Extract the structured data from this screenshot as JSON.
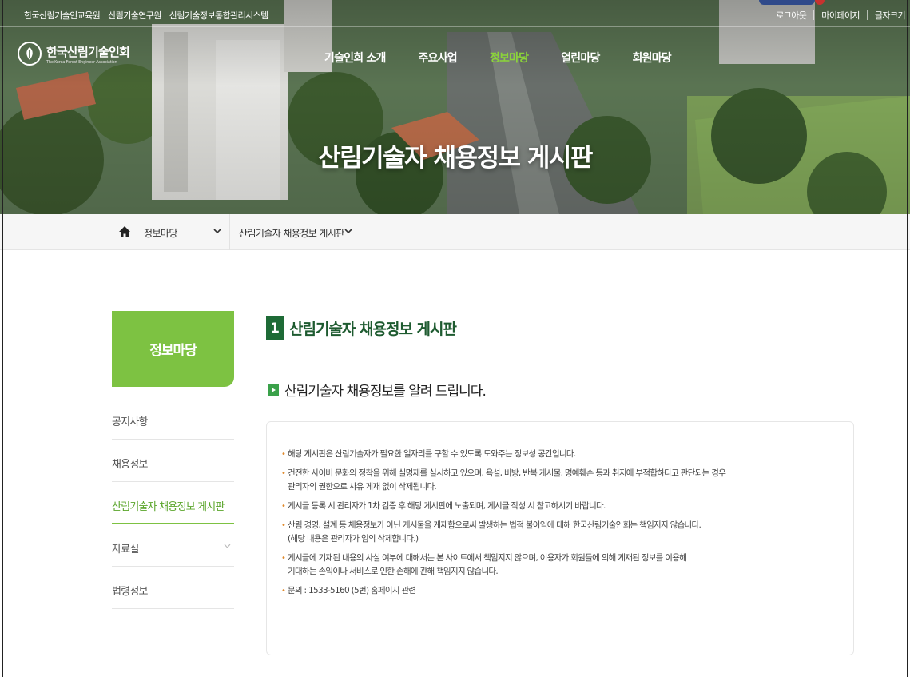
{
  "top_links_left": [
    "한국산림기술인교육원",
    "산림기술연구원",
    "산림기술정보통합관리시스템"
  ],
  "top_links_right": [
    "로그아웃",
    "마이페이지",
    "글자크기"
  ],
  "logo": {
    "title": "한국산림기술인회",
    "subtitle": "The Korea Forest Engineer Association"
  },
  "gnb": [
    "기술인회 소개",
    "주요사업",
    "정보마당",
    "열린마당",
    "회원마당"
  ],
  "gnb_active_index": 2,
  "hero_title": "산림기술자 채용정보 게시판",
  "breadcrumb": {
    "level1": "정보마당",
    "level2": "산림기술자 채용정보 게시판"
  },
  "lnb": {
    "title": "정보마당",
    "items": [
      {
        "label": "공지사항"
      },
      {
        "label": "채용정보"
      },
      {
        "label": "산림기술자 채용정보 게시판"
      },
      {
        "label": "자료실"
      },
      {
        "label": "법령정보"
      }
    ]
  },
  "section": {
    "number": "1",
    "title": "산림기술자 채용정보 게시판"
  },
  "subtitle": "산림기술자 채용정보를 알려 드립니다.",
  "notices": [
    [
      "해당 게시판은 산림기술자가 필요한 일자리를 구할 수 있도록 도와주는 정보성 공간입니다."
    ],
    [
      "건전한 사이버 문화의 정착을 위해 실명제를 실시하고 있으며, 욕설, 비방, 반복 게시물, 명예훼손 등과 취지에 부적합하다고 판단되는 경우",
      "관리자의 권한으로 사유 게재 없이 삭제됩니다."
    ],
    [
      "게시글 등록 시 관리자가 1차 검증 후 해당 게시판에 노출되며, 게시글 작성 시 참고하시기 바랍니다."
    ],
    [
      "산림 경영, 설계 등 채용정보가 아닌 게시물을 게재함으로써 발생하는 법적 불이익에 대해 한국산림기술인회는 책임지지 않습니다.",
      "(해당 내용은 관리자가 임의 삭제합니다.)"
    ],
    [
      "게시글에 기재된 내용의 사실 여부에 대해서는 본 사이트에서 책임지지 않으며, 이용자가 회원들에 의해 게재된 정보를 이용해",
      "기대하는 손익이나 서비스로 인한 손해에 관해 책임지지 않습니다."
    ],
    [
      "문의 : 1533-5160 (5번) 홈페이지 관련"
    ]
  ],
  "colors": {
    "accent_green": "#7dc242",
    "section_green": "#1e6b36",
    "gnb_active": "#8bd43a"
  }
}
